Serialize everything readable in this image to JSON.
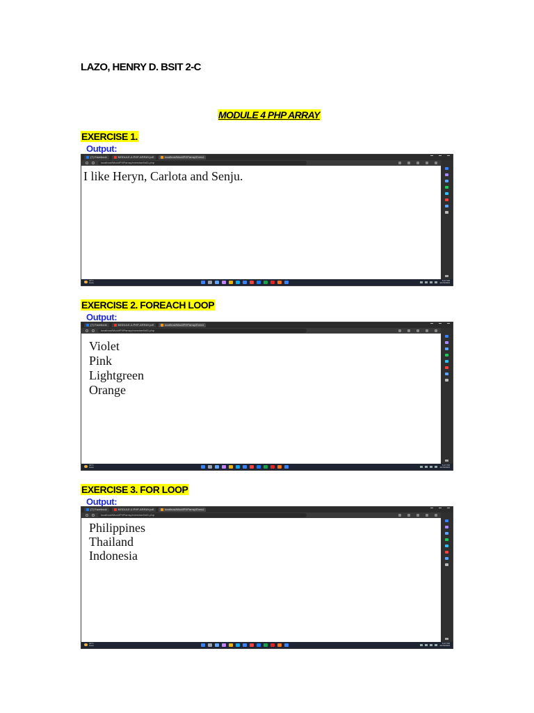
{
  "header": {
    "name": "LAZO, HENRY D. BSIT 2-C"
  },
  "module_title": "MODULE 4 PHP ARRAY",
  "exercises": [
    {
      "title": "EXERCISE 1.",
      "output_label": "Output:",
      "output_lines": [
        "I like Heryn, Carlota and Senju."
      ]
    },
    {
      "title": "EXERCISE 2. FOREACH LOOP",
      "output_label": "Output:",
      "output_lines": [
        "Violet",
        "Pink",
        "Lightgreen",
        "Orange"
      ]
    },
    {
      "title": "EXERCISE 3. FOR LOOP",
      "output_label": "Output:",
      "output_lines": [
        "Philippines",
        "Thailand",
        "Indonesia"
      ]
    }
  ],
  "browser": {
    "tabs": [
      "(7) Facebook",
      "MODULE-4-PHP-ARRAY.pdf",
      "localhost/Mod4PHParray/Exerci"
    ],
    "url": "localhost/Mod4PHParray/exercise/fa01.php",
    "weather": [
      "30°C",
      "Haze"
    ],
    "clock": [
      "5:27 PM",
      "11/15/2023"
    ]
  },
  "colors": {
    "highlight": "#ffff00",
    "output_label": "#1f2bd8",
    "taskbar": "#1f2433",
    "browser_chrome": "#2b2b2b"
  }
}
